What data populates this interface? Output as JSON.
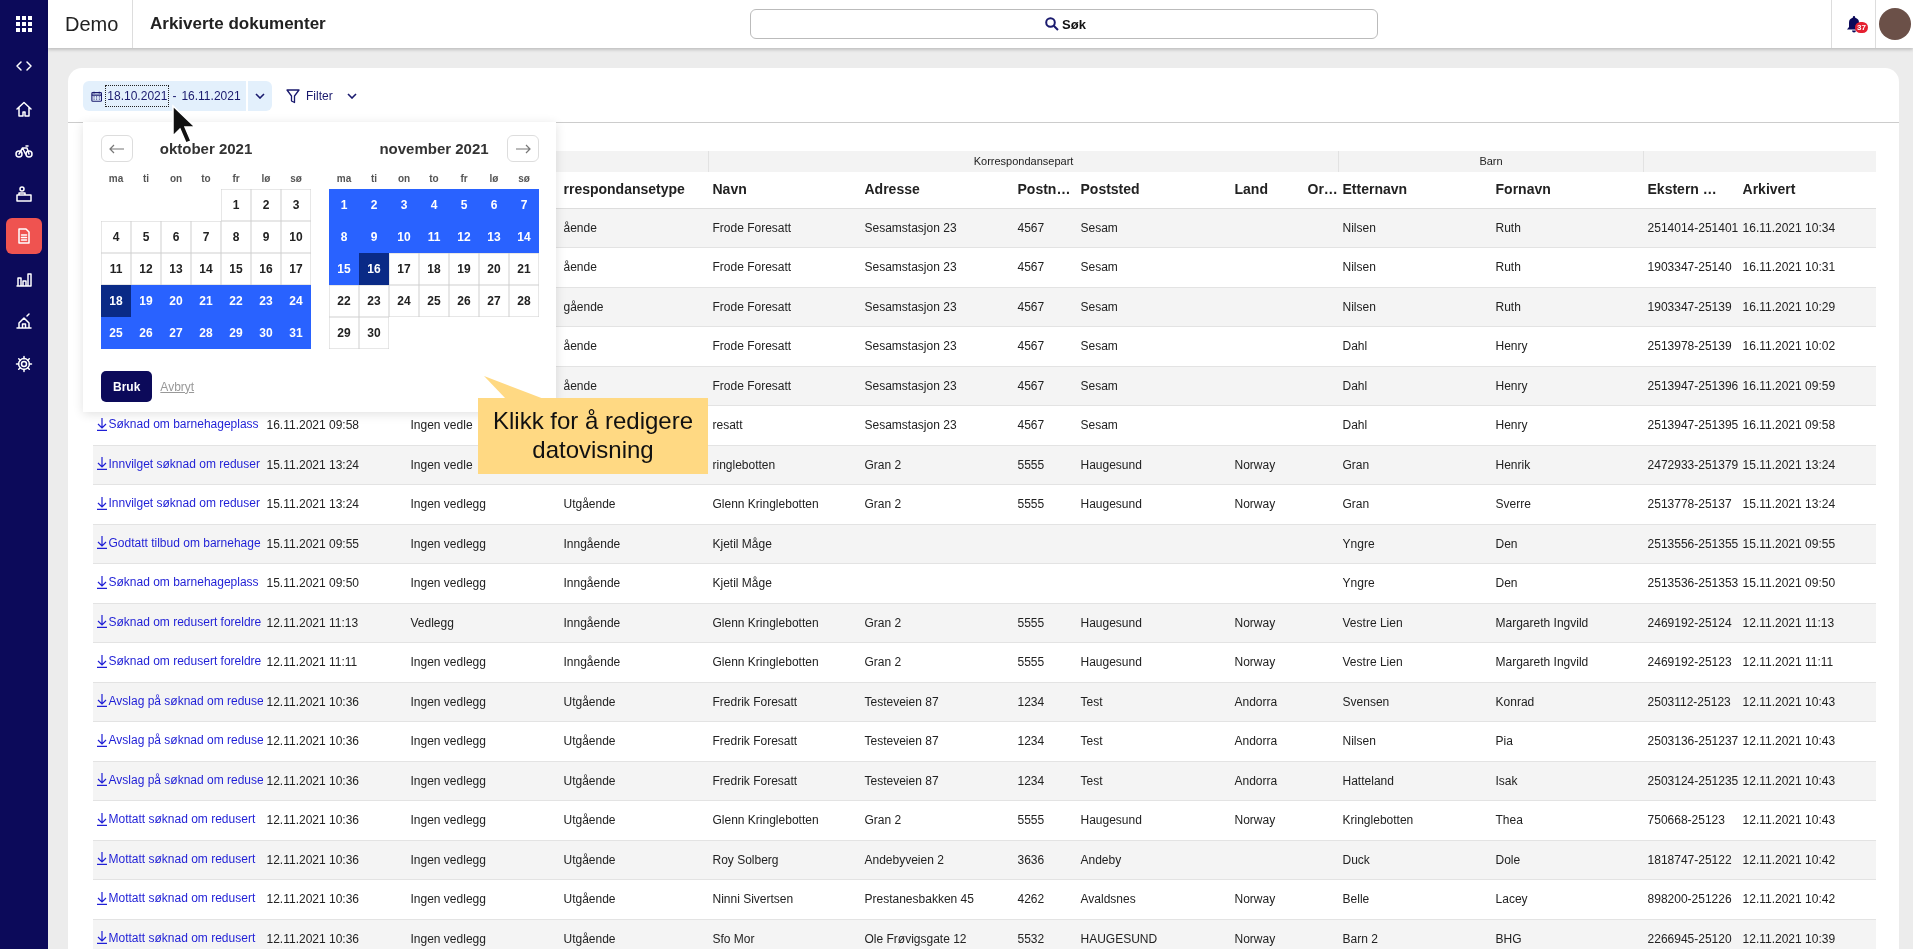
{
  "sidebar": {
    "items": [
      {
        "selected": false
      },
      {
        "selected": false
      },
      {
        "selected": false
      },
      {
        "selected": false
      },
      {
        "selected": true
      },
      {
        "selected": false
      },
      {
        "selected": false
      },
      {
        "selected": false
      }
    ]
  },
  "topbar": {
    "app": "Demo",
    "title": "Arkiverte dokumenter",
    "search": {
      "placeholder": "Søk"
    },
    "notifications": {
      "count": "37"
    }
  },
  "toolbar": {
    "date_range": {
      "start": {
        "text": "18.10.2021",
        "focused": true
      },
      "separator": "-",
      "end": "16.11.2021"
    },
    "filter": {
      "label": "Filter"
    }
  },
  "date_picker": {
    "months": [
      {
        "title": "oktober 2021",
        "weekdays": [
          "ma",
          "ti",
          "on",
          "to",
          "fr",
          "lø",
          "sø"
        ],
        "weeks": [
          {
            "kind": "end",
            "days": [
              {
                "day": "1",
                "in_range": false,
                "endpoint": false
              },
              {
                "day": "2",
                "in_range": false,
                "endpoint": false
              },
              {
                "day": "3",
                "in_range": false,
                "endpoint": false
              }
            ]
          },
          {
            "kind": "full",
            "days": [
              {
                "day": "4",
                "in_range": false,
                "endpoint": false
              },
              {
                "day": "5",
                "in_range": false,
                "endpoint": false
              },
              {
                "day": "6",
                "in_range": false,
                "endpoint": false
              },
              {
                "day": "7",
                "in_range": false,
                "endpoint": false
              },
              {
                "day": "8",
                "in_range": false,
                "endpoint": false
              },
              {
                "day": "9",
                "in_range": false,
                "endpoint": false
              },
              {
                "day": "10",
                "in_range": false,
                "endpoint": false
              }
            ]
          },
          {
            "kind": "full",
            "days": [
              {
                "day": "11",
                "in_range": false,
                "endpoint": false
              },
              {
                "day": "12",
                "in_range": false,
                "endpoint": false
              },
              {
                "day": "13",
                "in_range": false,
                "endpoint": false
              },
              {
                "day": "14",
                "in_range": false,
                "endpoint": false
              },
              {
                "day": "15",
                "in_range": false,
                "endpoint": false
              },
              {
                "day": "16",
                "in_range": false,
                "endpoint": false
              },
              {
                "day": "17",
                "in_range": false,
                "endpoint": false
              }
            ]
          },
          {
            "kind": "full",
            "days": [
              {
                "day": "18",
                "in_range": true,
                "endpoint": true
              },
              {
                "day": "19",
                "in_range": true,
                "endpoint": false
              },
              {
                "day": "20",
                "in_range": true,
                "endpoint": false
              },
              {
                "day": "21",
                "in_range": true,
                "endpoint": false
              },
              {
                "day": "22",
                "in_range": true,
                "endpoint": false
              },
              {
                "day": "23",
                "in_range": true,
                "endpoint": false
              },
              {
                "day": "24",
                "in_range": true,
                "endpoint": false
              }
            ]
          },
          {
            "kind": "full",
            "days": [
              {
                "day": "25",
                "in_range": true,
                "endpoint": false
              },
              {
                "day": "26",
                "in_range": true,
                "endpoint": false
              },
              {
                "day": "27",
                "in_range": true,
                "endpoint": false
              },
              {
                "day": "28",
                "in_range": true,
                "endpoint": false
              },
              {
                "day": "29",
                "in_range": true,
                "endpoint": false
              },
              {
                "day": "30",
                "in_range": true,
                "endpoint": false
              },
              {
                "day": "31",
                "in_range": true,
                "endpoint": false
              }
            ]
          }
        ]
      },
      {
        "title": "november 2021",
        "weekdays": [
          "ma",
          "ti",
          "on",
          "to",
          "fr",
          "lø",
          "sø"
        ],
        "weeks": [
          {
            "kind": "full",
            "days": [
              {
                "day": "1",
                "in_range": true,
                "endpoint": false
              },
              {
                "day": "2",
                "in_range": true,
                "endpoint": false
              },
              {
                "day": "3",
                "in_range": true,
                "endpoint": false
              },
              {
                "day": "4",
                "in_range": true,
                "endpoint": false
              },
              {
                "day": "5",
                "in_range": true,
                "endpoint": false
              },
              {
                "day": "6",
                "in_range": true,
                "endpoint": false
              },
              {
                "day": "7",
                "in_range": true,
                "endpoint": false
              }
            ]
          },
          {
            "kind": "full",
            "days": [
              {
                "day": "8",
                "in_range": true,
                "endpoint": false
              },
              {
                "day": "9",
                "in_range": true,
                "endpoint": false
              },
              {
                "day": "10",
                "in_range": true,
                "endpoint": false
              },
              {
                "day": "11",
                "in_range": true,
                "endpoint": false
              },
              {
                "day": "12",
                "in_range": true,
                "endpoint": false
              },
              {
                "day": "13",
                "in_range": true,
                "endpoint": false
              },
              {
                "day": "14",
                "in_range": true,
                "endpoint": false
              }
            ]
          },
          {
            "kind": "full",
            "days": [
              {
                "day": "15",
                "in_range": true,
                "endpoint": false
              },
              {
                "day": "16",
                "in_range": true,
                "endpoint": true
              },
              {
                "day": "17",
                "in_range": false,
                "endpoint": false
              },
              {
                "day": "18",
                "in_range": false,
                "endpoint": false
              },
              {
                "day": "19",
                "in_range": false,
                "endpoint": false
              },
              {
                "day": "20",
                "in_range": false,
                "endpoint": false
              },
              {
                "day": "21",
                "in_range": false,
                "endpoint": false
              }
            ]
          },
          {
            "kind": "full",
            "days": [
              {
                "day": "22",
                "in_range": false,
                "endpoint": false
              },
              {
                "day": "23",
                "in_range": false,
                "endpoint": false
              },
              {
                "day": "24",
                "in_range": false,
                "endpoint": false
              },
              {
                "day": "25",
                "in_range": false,
                "endpoint": false
              },
              {
                "day": "26",
                "in_range": false,
                "endpoint": false
              },
              {
                "day": "27",
                "in_range": false,
                "endpoint": false
              },
              {
                "day": "28",
                "in_range": false,
                "endpoint": false
              }
            ]
          },
          {
            "kind": "start",
            "days": [
              {
                "day": "29",
                "in_range": false,
                "endpoint": false
              },
              {
                "day": "30",
                "in_range": false,
                "endpoint": false
              }
            ]
          }
        ]
      }
    ],
    "apply": "Bruk",
    "cancel": "Avbryt"
  },
  "tooltip": {
    "text": "Klikk for å redigere datovisning"
  },
  "table": {
    "column_groups": [
      {
        "columns": [
          null,
          null,
          null,
          "rrespondansetype"
        ]
      },
      {
        "label": "Korrespondansepart",
        "columns": [
          "Navn",
          "Adresse",
          "Postn…",
          "Poststed",
          "Land",
          "Or…"
        ]
      },
      {
        "label": "Barn",
        "columns": [
          "Etternavn",
          "Fornavn"
        ]
      },
      {
        "columns": [
          "Ekstern …",
          "Arkivert"
        ]
      }
    ],
    "rows": [
      [
        null,
        null,
        null,
        "ående",
        "Frode Foresatt",
        "Sesamstasjon 23",
        "4567",
        "Sesam",
        null,
        null,
        "Nilsen",
        "Ruth",
        "2514014-251401",
        "16.11.2021 10:34"
      ],
      [
        null,
        null,
        null,
        "ående",
        "Frode Foresatt",
        "Sesamstasjon 23",
        "4567",
        "Sesam",
        null,
        null,
        "Nilsen",
        "Ruth",
        "1903347-25140",
        "16.11.2021 10:31"
      ],
      [
        null,
        null,
        null,
        "gående",
        "Frode Foresatt",
        "Sesamstasjon 23",
        "4567",
        "Sesam",
        null,
        null,
        "Nilsen",
        "Ruth",
        "1903347-25139",
        "16.11.2021 10:29"
      ],
      [
        null,
        null,
        null,
        "ående",
        "Frode Foresatt",
        "Sesamstasjon 23",
        "4567",
        "Sesam",
        null,
        null,
        "Dahl",
        "Henry",
        "2513978-25139",
        "16.11.2021 10:02"
      ],
      [
        null,
        null,
        null,
        "ående",
        "Frode Foresatt",
        "Sesamstasjon 23",
        "4567",
        "Sesam",
        null,
        null,
        "Dahl",
        "Henry",
        "2513947-251396",
        "16.11.2021 09:59"
      ],
      [
        "Søknad om barnehageplass",
        "16.11.2021 09:58",
        "Ingen vedle",
        null,
        "resatt",
        "Sesamstasjon 23",
        "4567",
        "Sesam",
        null,
        null,
        "Dahl",
        "Henry",
        "2513947-251395",
        "16.11.2021 09:58"
      ],
      [
        "Innvilget søknad om reduser",
        "15.11.2021 13:24",
        "Ingen vedle",
        null,
        "ringlebotten",
        "Gran 2",
        "5555",
        "Haugesund",
        "Norway",
        null,
        "Gran",
        "Henrik",
        "2472933-251379",
        "15.11.2021 13:24"
      ],
      [
        "Innvilget søknad om reduser",
        "15.11.2021 13:24",
        "Ingen vedlegg",
        "Utgående",
        "Glenn Kringlebotten",
        "Gran 2",
        "5555",
        "Haugesund",
        "Norway",
        null,
        "Gran",
        "Sverre",
        "2513778-25137",
        "15.11.2021 13:24"
      ],
      [
        "Godtatt tilbud om barnehage",
        "15.11.2021 09:55",
        "Ingen vedlegg",
        "Inngående",
        "Kjetil Måge",
        null,
        null,
        null,
        null,
        null,
        "Yngre",
        "Den",
        "2513556-251355",
        "15.11.2021 09:55"
      ],
      [
        "Søknad om barnehageplass",
        "15.11.2021 09:50",
        "Ingen vedlegg",
        "Inngående",
        "Kjetil Måge",
        null,
        null,
        null,
        null,
        null,
        "Yngre",
        "Den",
        "2513536-251353",
        "15.11.2021 09:50"
      ],
      [
        "Søknad om redusert foreldre",
        "12.11.2021 11:13",
        "Vedlegg",
        "Inngående",
        "Glenn Kringlebotten",
        "Gran 2",
        "5555",
        "Haugesund",
        "Norway",
        null,
        "Vestre Lien",
        "Margareth Ingvild",
        "2469192-25124",
        "12.11.2021 11:13"
      ],
      [
        "Søknad om redusert foreldre",
        "12.11.2021 11:11",
        "Ingen vedlegg",
        "Inngående",
        "Glenn Kringlebotten",
        "Gran 2",
        "5555",
        "Haugesund",
        "Norway",
        null,
        "Vestre Lien",
        "Margareth Ingvild",
        "2469192-25123",
        "12.11.2021 11:11"
      ],
      [
        "Avslag på søknad om reduse",
        "12.11.2021 10:36",
        "Ingen vedlegg",
        "Utgående",
        "Fredrik Foresatt",
        "Testeveien 87",
        "1234",
        "Test",
        "Andorra",
        null,
        "Svensen",
        "Konrad",
        "2503112-25123",
        "12.11.2021 10:43"
      ],
      [
        "Avslag på søknad om reduse",
        "12.11.2021 10:36",
        "Ingen vedlegg",
        "Utgående",
        "Fredrik Foresatt",
        "Testeveien 87",
        "1234",
        "Test",
        "Andorra",
        null,
        "Nilsen",
        "Pia",
        "2503136-251237",
        "12.11.2021 10:43"
      ],
      [
        "Avslag på søknad om reduse",
        "12.11.2021 10:36",
        "Ingen vedlegg",
        "Utgående",
        "Fredrik Foresatt",
        "Testeveien 87",
        "1234",
        "Test",
        "Andorra",
        null,
        "Hatteland",
        "Isak",
        "2503124-251235",
        "12.11.2021 10:43"
      ],
      [
        "Mottatt søknad om redusert",
        "12.11.2021 10:36",
        "Ingen vedlegg",
        "Utgående",
        "Glenn Kringlebotten",
        "Gran 2",
        "5555",
        "Haugesund",
        "Norway",
        null,
        "Kringlebotten",
        "Thea",
        "750668-25123",
        "12.11.2021 10:43"
      ],
      [
        "Mottatt søknad om redusert",
        "12.11.2021 10:36",
        "Ingen vedlegg",
        "Utgående",
        "Roy Solberg",
        "Andebyveien 2",
        "3636",
        "Andeby",
        null,
        null,
        "Duck",
        "Dole",
        "1818747-25122",
        "12.11.2021 10:42"
      ],
      [
        "Mottatt søknad om redusert",
        "12.11.2021 10:36",
        "Ingen vedlegg",
        "Utgående",
        "Ninni Sivertsen",
        "Prestanesbakken 45",
        "4262",
        "Avaldsnes",
        "Norway",
        null,
        "Belle",
        "Lacey",
        "898200-251226",
        "12.11.2021 10:42"
      ],
      [
        "Mottatt søknad om redusert",
        "12.11.2021 10:36",
        "Ingen vedlegg",
        "Utgående",
        "Sfo Mor",
        "Ole Frøvigsgate 12",
        "5532",
        "HAUGESUND",
        "Norway",
        null,
        "Barn 2",
        "BHG",
        "2266945-25120",
        "12.11.2021 10:39"
      ]
    ]
  }
}
